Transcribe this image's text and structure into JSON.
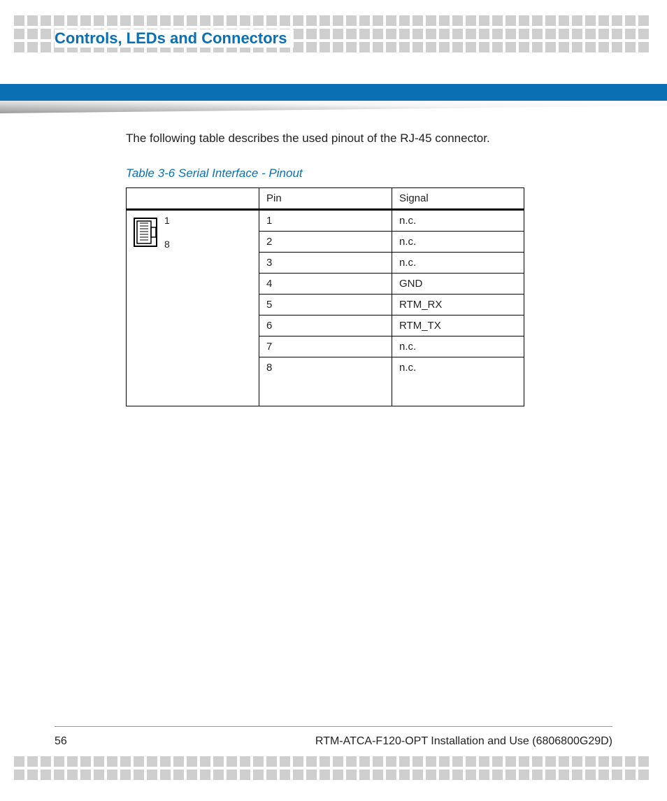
{
  "header": {
    "chapter_title": "Controls, LEDs and Connectors"
  },
  "main": {
    "intro_text": "The following table describes the used pinout of the RJ-45 connector.",
    "table_caption": "Table 3-6 Serial Interface - Pinout",
    "table": {
      "headers": {
        "pin": "Pin",
        "signal": "Signal"
      },
      "diagram_labels": {
        "top": "1",
        "bottom": "8"
      },
      "rows": [
        {
          "pin": "1",
          "signal": "n.c."
        },
        {
          "pin": "2",
          "signal": "n.c."
        },
        {
          "pin": "3",
          "signal": "n.c."
        },
        {
          "pin": "4",
          "signal": "GND"
        },
        {
          "pin": "5",
          "signal": "RTM_RX"
        },
        {
          "pin": "6",
          "signal": "RTM_TX"
        },
        {
          "pin": "7",
          "signal": "n.c."
        },
        {
          "pin": "8",
          "signal": "n.c."
        }
      ]
    }
  },
  "footer": {
    "page_number": "56",
    "doc_title": "RTM-ATCA-F120-OPT Installation and Use (6806800G29D)"
  }
}
